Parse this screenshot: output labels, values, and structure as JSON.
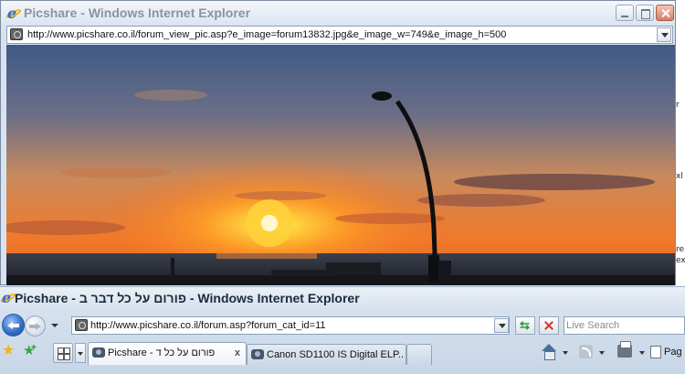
{
  "popup": {
    "title": "Picshare - Windows Internet Explorer",
    "address": "http://www.picshare.co.il/forum_view_pic.asp?e_image=forum13832.jpg&e_image_w=749&e_image_h=500"
  },
  "main": {
    "title": "Picshare - פורום על כל דבר ב - Windows Internet Explorer",
    "address": "http://www.picshare.co.il/forum.asp?forum_cat_id=11",
    "search_placeholder": "Live Search",
    "tabs": [
      {
        "label": "Picshare - פורום על כל ד",
        "close": "x"
      },
      {
        "label": "Canon SD1100 IS Digital ELP..."
      }
    ],
    "page_label": "Pag"
  },
  "backdrop_fragments": [
    "r",
    "xl",
    "re",
    "ex"
  ]
}
